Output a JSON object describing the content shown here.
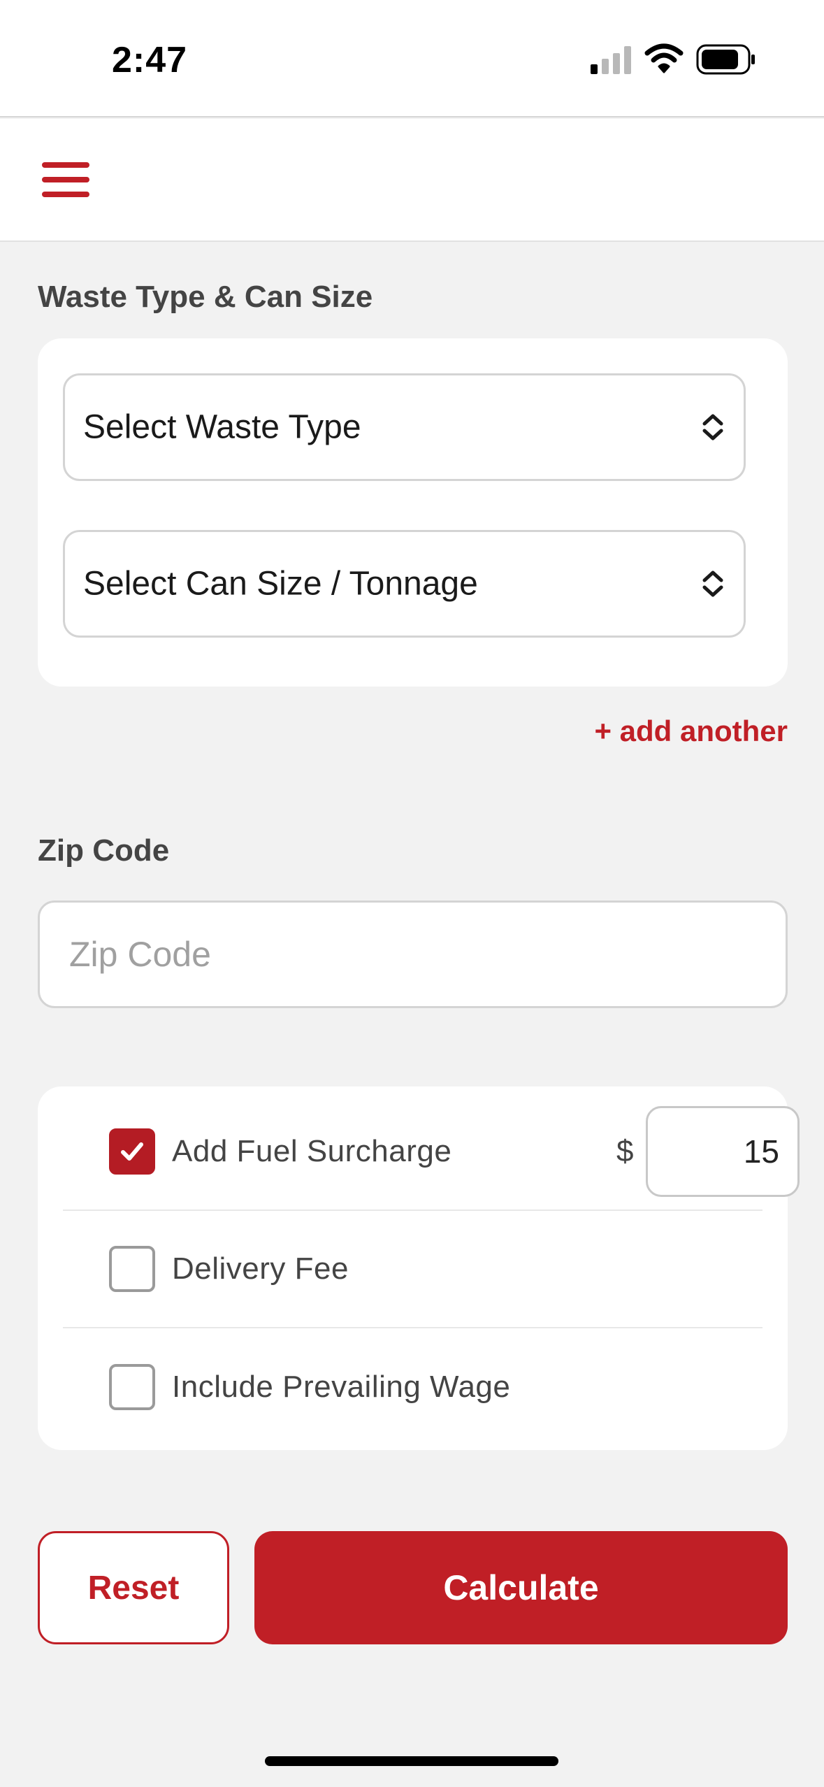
{
  "status_bar": {
    "time": "2:47",
    "icons": [
      "cellular-signal-icon",
      "wifi-icon",
      "battery-icon"
    ]
  },
  "header": {
    "menu_icon": "hamburger-menu-icon",
    "accent_color": "#c01f26"
  },
  "waste_section": {
    "title": "Waste Type & Can Size",
    "waste_type_select": "Select Waste Type",
    "can_size_select": "Select Can Size / Tonnage",
    "add_another": "+ add another"
  },
  "zip_section": {
    "title": "Zip Code",
    "placeholder": "Zip Code",
    "value": ""
  },
  "options": [
    {
      "label": "Add Fuel Surcharge",
      "checked": true,
      "currency": "$",
      "amount": "15"
    },
    {
      "label": "Delivery Fee",
      "checked": false
    },
    {
      "label": "Include Prevailing Wage",
      "checked": false
    }
  ],
  "actions": {
    "reset_label": "Reset",
    "calculate_label": "Calculate"
  }
}
